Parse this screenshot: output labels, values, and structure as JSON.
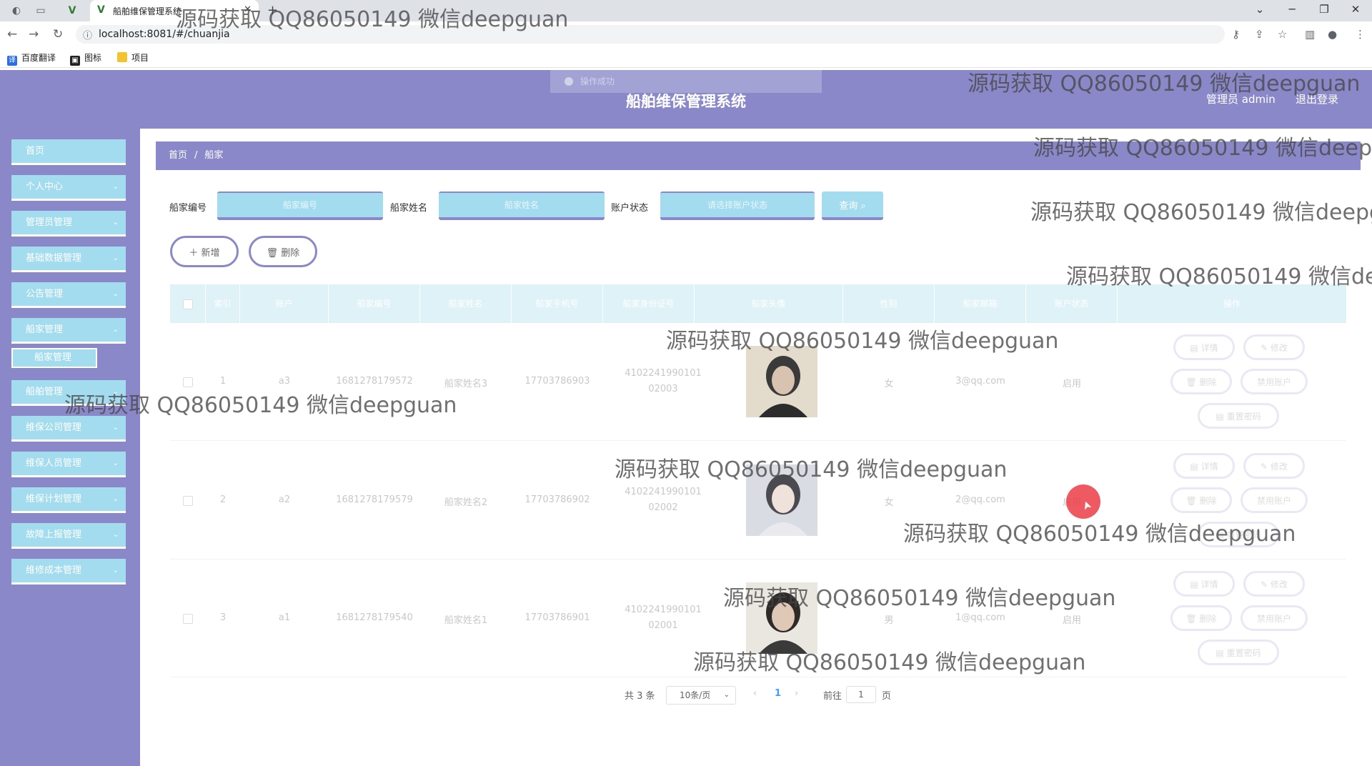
{
  "browser": {
    "tab_title": "船舶维保管理系统",
    "url": "localhost:8081/#/chuanjia",
    "bookmarks": [
      "百度翻译",
      "图标",
      "项目"
    ]
  },
  "header": {
    "ghost_label": "操作成功",
    "system_name": "船舶维保管理系统",
    "user": "管理员 admin",
    "logout": "退出登录"
  },
  "sidebar": {
    "items": [
      {
        "label": "首页",
        "has_sub": false
      },
      {
        "label": "个人中心",
        "has_sub": true
      },
      {
        "label": "管理员管理",
        "has_sub": true
      },
      {
        "label": "基础数据管理",
        "has_sub": true
      },
      {
        "label": "公告管理",
        "has_sub": true
      },
      {
        "label": "船家管理",
        "has_sub": true
      },
      {
        "label": "船舶管理",
        "has_sub": true
      },
      {
        "label": "维保公司管理",
        "has_sub": true
      },
      {
        "label": "维保人员管理",
        "has_sub": true
      },
      {
        "label": "维保计划管理",
        "has_sub": true
      },
      {
        "label": "故障上报管理",
        "has_sub": true
      },
      {
        "label": "维修成本管理",
        "has_sub": true
      }
    ],
    "active_sub": "船家管理"
  },
  "breadcrumb": {
    "home": "首页",
    "separator": "/",
    "current": "船家"
  },
  "search": {
    "field1_label": "船家编号",
    "field1_placeholder": "船家编号",
    "field2_label": "船家姓名",
    "field2_placeholder": "船家姓名",
    "field3_label": "账户状态",
    "field3_placeholder": "请选择账户状态",
    "query_label": "查询 ⌕"
  },
  "actions": {
    "add_label": "＋ 新增",
    "delete_label": "🗑 删除"
  },
  "table": {
    "headers": [
      "索引",
      "账户",
      "船家编号",
      "船家姓名",
      "船家手机号",
      "船家身份证号",
      "船家头像",
      "性别",
      "船家邮箱",
      "账户状态",
      "操作"
    ],
    "rows": [
      {
        "index": "1",
        "account": "a3",
        "code": "1681278179572",
        "name": "船家姓名3",
        "phone": "17703786903",
        "id_card_1": "4102241990101",
        "id_card_2": "02003",
        "gender": "女",
        "email": "3@qq.com",
        "status": "启用"
      },
      {
        "index": "2",
        "account": "a2",
        "code": "1681278179579",
        "name": "船家姓名2",
        "phone": "17703786902",
        "id_card_1": "4102241990101",
        "id_card_2": "02002",
        "gender": "女",
        "email": "2@qq.com",
        "status": "启用"
      },
      {
        "index": "3",
        "account": "a1",
        "code": "1681278179540",
        "name": "船家姓名1",
        "phone": "17703786901",
        "id_card_1": "4102241990101",
        "id_card_2": "02001",
        "gender": "男",
        "email": "1@qq.com",
        "status": "启用"
      }
    ],
    "row_actions": {
      "detail": "详情",
      "edit": "修改",
      "delete": "删除",
      "disable": "禁用账户",
      "reset": "重置密码"
    }
  },
  "pagination": {
    "total": "共 3 条",
    "page_size": "10条/页",
    "prev": "‹",
    "current_page": "1",
    "next": "›",
    "goto_label": "前往",
    "goto_value": "1",
    "page_unit": "页"
  },
  "watermark": {
    "text": "源码获取 QQ86050149 微信deepguan"
  }
}
